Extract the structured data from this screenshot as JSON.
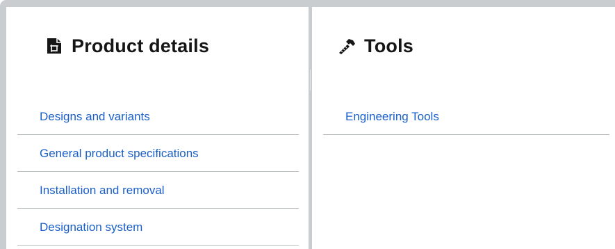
{
  "colors": {
    "frame": "#c9cdd0",
    "heading": "#161616",
    "link": "#1a5fc8",
    "rule": "#b7bcbf"
  },
  "product_details": {
    "icon": "product-document-icon",
    "title": "Product details",
    "links": [
      "Designs and variants",
      "General product specifications",
      "Installation and removal",
      "Designation system"
    ]
  },
  "tools": {
    "icon": "hammer-ruler-icon",
    "title": "Tools",
    "links": [
      "Engineering Tools"
    ]
  }
}
